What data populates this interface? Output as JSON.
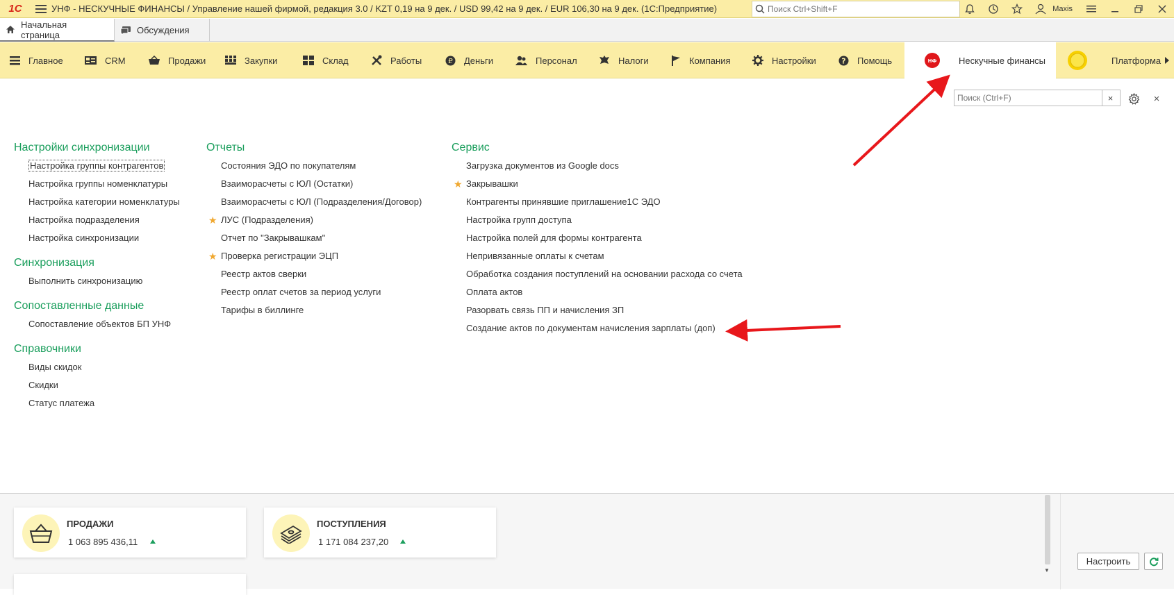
{
  "titlebar": {
    "logo": "1С",
    "title": "УНФ - НЕСКУЧНЫЕ ФИНАНСЫ / Управление нашей фирмой, редакция 3.0 / KZT 0,19 на 9 дек. / USD 99,42 на 9 дек. / EUR 106,30 на 9 дек.  (1С:Предприятие)",
    "search_placeholder": "Поиск Ctrl+Shift+F",
    "user": "Maxis"
  },
  "tabs": [
    {
      "label": "Начальная страница",
      "icon": "home-icon",
      "active": true
    },
    {
      "label": "Обсуждения",
      "icon": "chat-icon",
      "active": false
    }
  ],
  "sections": [
    {
      "label": "Главное",
      "icon": "menu-lines-icon"
    },
    {
      "label": "CRM",
      "icon": "crm-card-icon"
    },
    {
      "label": "Продажи",
      "icon": "basket-icon"
    },
    {
      "label": "Закупки",
      "icon": "purchases-grid-icon"
    },
    {
      "label": "Склад",
      "icon": "warehouse-icon"
    },
    {
      "label": "Работы",
      "icon": "tools-icon"
    },
    {
      "label": "Деньги",
      "icon": "ruble-coin-icon"
    },
    {
      "label": "Персонал",
      "icon": "people-icon"
    },
    {
      "label": "Налоги",
      "icon": "eagle-emblem-icon"
    },
    {
      "label": "Компания",
      "icon": "flag-icon"
    },
    {
      "label": "Настройки",
      "icon": "gear-icon"
    },
    {
      "label": "Помощь",
      "icon": "help-icon"
    },
    {
      "label": "Нескучные финансы",
      "icon": "nf-logo-icon",
      "badge": "НФ",
      "active": true
    },
    {
      "label": "Платформа",
      "icon": "platform-coin-icon"
    }
  ],
  "content": {
    "search_placeholder": "Поиск (Ctrl+F)",
    "clear": "×",
    "close": "×",
    "columns": [
      {
        "groups": [
          {
            "title": "Настройки синхронизации",
            "items": [
              {
                "label": "Настройка группы контрагентов",
                "focused": true
              },
              {
                "label": "Настройка группы номенклатуры"
              },
              {
                "label": "Настройка категории номенклатуры"
              },
              {
                "label": "Настройка подразделения"
              },
              {
                "label": "Настройка синхронизации"
              }
            ]
          },
          {
            "title": "Синхронизация",
            "items": [
              {
                "label": "Выполнить синхронизацию"
              }
            ]
          },
          {
            "title": "Сопоставленные данные",
            "items": [
              {
                "label": "Сопоставление объектов БП УНФ"
              }
            ]
          },
          {
            "title": "Справочники",
            "items": [
              {
                "label": "Виды скидок"
              },
              {
                "label": "Скидки"
              },
              {
                "label": "Статус платежа"
              }
            ]
          }
        ]
      },
      {
        "groups": [
          {
            "title": "Отчеты",
            "items": [
              {
                "label": "Состояния ЭДО по покупателям"
              },
              {
                "label": "Взаиморасчеты с ЮЛ (Остатки)"
              },
              {
                "label": "Взаиморасчеты с ЮЛ (Подразделения/Договор)"
              },
              {
                "label": "ЛУС (Подразделения)",
                "star": true
              },
              {
                "label": "Отчет по \"Закрывашкам\""
              },
              {
                "label": "Проверка регистрации ЭЦП",
                "star": true
              },
              {
                "label": "Реестр актов сверки"
              },
              {
                "label": "Реестр оплат счетов за период услуги"
              },
              {
                "label": "Тарифы в биллинге"
              }
            ]
          }
        ]
      },
      {
        "groups": [
          {
            "title": "Сервис",
            "items": [
              {
                "label": "Загрузка документов из Google docs"
              },
              {
                "label": "Закрывашки",
                "star": true
              },
              {
                "label": "Контрагенты принявшие приглашение1С ЭДО"
              },
              {
                "label": "Настройка групп доступа"
              },
              {
                "label": "Настройка полей для формы контрагента"
              },
              {
                "label": "Непривязанные оплаты к счетам"
              },
              {
                "label": "Обработка создания поступлений на основании расхода со счета"
              },
              {
                "label": "Оплата актов"
              },
              {
                "label": "Разорвать связь ПП и начисления ЗП"
              },
              {
                "label": "Создание актов по документам начисления зарплаты (доп)"
              }
            ]
          }
        ]
      }
    ]
  },
  "widgets": [
    {
      "title": "ПРОДАЖИ",
      "value": "1 063 895 436,11",
      "icon": "basket-icon",
      "trend": "up"
    },
    {
      "title": "ПОСТУПЛЕНИЯ",
      "value": "1 171 084 237,20",
      "icon": "money-stack-icon",
      "trend": "up"
    }
  ],
  "bottom_buttons": {
    "configure": "Настроить",
    "refresh_icon": "refresh-icon"
  },
  "colors": {
    "accent_yellow": "#fbeda5",
    "group_title_green": "#1a9e5c",
    "arrow_red": "#e8171b",
    "star": "#f0a830"
  }
}
